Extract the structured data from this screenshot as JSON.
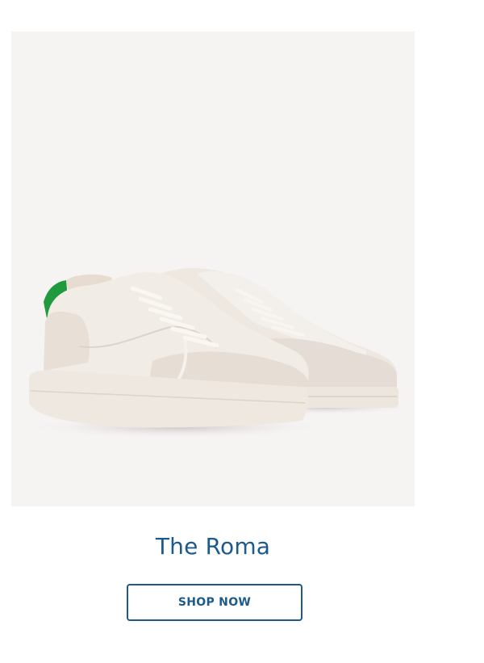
{
  "product": {
    "name": "The Roma",
    "cta_label": "SHOP NOW",
    "image_icon": "sneaker-pair-image"
  },
  "colors": {
    "accent": "#1c5a8c",
    "image_background": "#f6f3f3",
    "heel_tab": "#1f9a3c",
    "shoe_body": "#efe9e2"
  }
}
